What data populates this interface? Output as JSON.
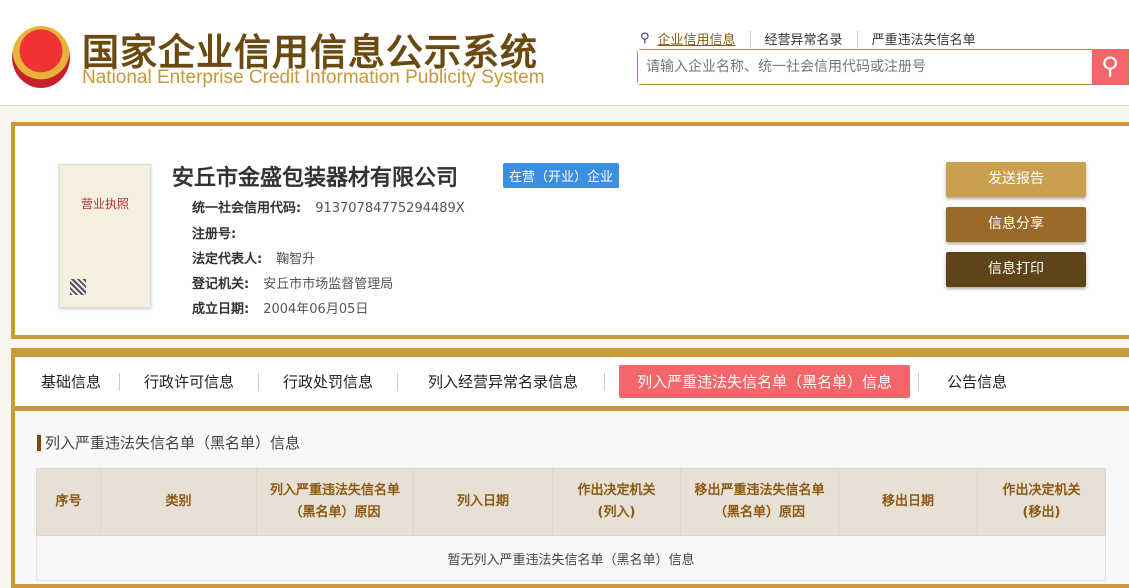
{
  "header": {
    "title_cn": "国家企业信用信息公示系统",
    "title_en": "National Enterprise Credit Information Publicity System",
    "links": [
      "企业信用信息",
      "经营异常名录",
      "严重违法失信名单"
    ],
    "search_placeholder": "请输入企业名称、统一社会信用代码或注册号"
  },
  "company": {
    "license_label": "营业执照",
    "name": "安丘市金盛包装器材有限公司",
    "status": "在营（开业）企业",
    "fields": [
      {
        "label": "统一社会信用代码:",
        "value": "91370784775294489X"
      },
      {
        "label": "注册号:",
        "value": ""
      },
      {
        "label": "法定代表人:",
        "value": "鞠智升"
      },
      {
        "label": "登记机关:",
        "value": "安丘市市场监督管理局"
      },
      {
        "label": "成立日期:",
        "value": "2004年06月05日"
      }
    ],
    "buttons": [
      "发送报告",
      "信息分享",
      "信息打印"
    ]
  },
  "tabs": [
    "基础信息",
    "行政许可信息",
    "行政处罚信息",
    "列入经营异常名录信息",
    "列入严重违法失信名单（黑名单）信息",
    "公告信息"
  ],
  "section": {
    "title": "列入严重违法失信名单（黑名单）信息",
    "columns": [
      "序号",
      "类别",
      "列入严重违法失信名单（黑名单）原因",
      "列入日期",
      "作出决定机关(列入)",
      "移出严重违法失信名单（黑名单）原因",
      "移出日期",
      "作出决定机关(移出)"
    ],
    "empty": "暂无列入严重违法失信名单（黑名单）信息"
  },
  "colors": {
    "gold": "#c99a3a",
    "active_tab": "#f5666a",
    "badge": "#3c8ee0"
  }
}
